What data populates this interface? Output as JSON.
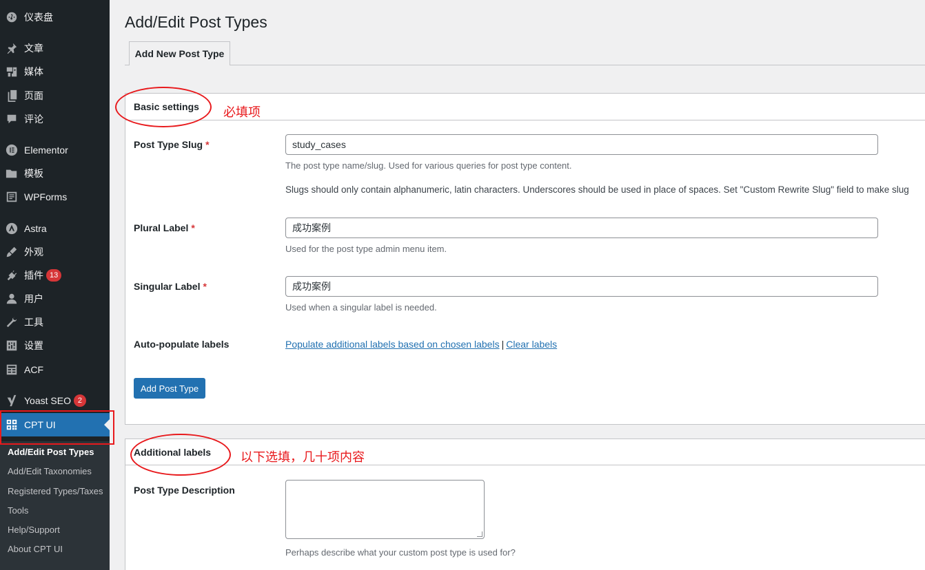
{
  "sidebar": {
    "items": [
      {
        "label": "仪表盘",
        "icon": "dashboard-icon"
      },
      {
        "label": "文章",
        "icon": "pin-icon"
      },
      {
        "label": "媒体",
        "icon": "media-icon"
      },
      {
        "label": "页面",
        "icon": "page-icon"
      },
      {
        "label": "评论",
        "icon": "comment-icon"
      },
      {
        "label": "Elementor",
        "icon": "elementor-icon"
      },
      {
        "label": "模板",
        "icon": "folder-icon"
      },
      {
        "label": "WPForms",
        "icon": "forms-icon"
      },
      {
        "label": "Astra",
        "icon": "astra-icon"
      },
      {
        "label": "外观",
        "icon": "brush-icon"
      },
      {
        "label": "插件",
        "icon": "plugin-icon",
        "badge": "13"
      },
      {
        "label": "用户",
        "icon": "user-icon"
      },
      {
        "label": "工具",
        "icon": "wrench-icon"
      },
      {
        "label": "设置",
        "icon": "settings-icon"
      },
      {
        "label": "ACF",
        "icon": "acf-icon"
      },
      {
        "label": "Yoast SEO",
        "icon": "yoast-icon",
        "badge": "2"
      },
      {
        "label": "CPT UI",
        "icon": "cptui-icon"
      }
    ],
    "submenu": [
      "Add/Edit Post Types",
      "Add/Edit Taxonomies",
      "Registered Types/Taxes",
      "Tools",
      "Help/Support",
      "About CPT UI"
    ]
  },
  "main": {
    "title": "Add/Edit Post Types",
    "tab": "Add New Post Type",
    "basic": {
      "header": "Basic settings",
      "slug_label": "Post Type Slug",
      "slug_value": "study_cases",
      "slug_desc1": "The post type name/slug. Used for various queries for post type content.",
      "slug_desc2": "Slugs should only contain alphanumeric, latin characters. Underscores should be used in place of spaces. Set \"Custom Rewrite Slug\" field to make slug",
      "plural_label": "Plural Label",
      "plural_value": "成功案例",
      "plural_desc": "Used for the post type admin menu item.",
      "singular_label": "Singular Label",
      "singular_value": "成功案例",
      "singular_desc": "Used when a singular label is needed.",
      "auto_label": "Auto-populate labels",
      "populate_link": "Populate additional labels based on chosen labels",
      "separator": "|",
      "clear_link": "Clear labels",
      "add_button": "Add Post Type",
      "required_mark": "*"
    },
    "additional": {
      "header": "Additional labels",
      "desc_label": "Post Type Description",
      "desc_help": "Perhaps describe what your custom post type is used for?"
    }
  },
  "annotations": {
    "required_note": "必填项",
    "optional_note": "以下选填，几十项内容"
  },
  "colors": {
    "sidebar_bg": "#1d2327",
    "accent": "#2271b1",
    "annotation": "#e8191c",
    "badge": "#d63638"
  }
}
